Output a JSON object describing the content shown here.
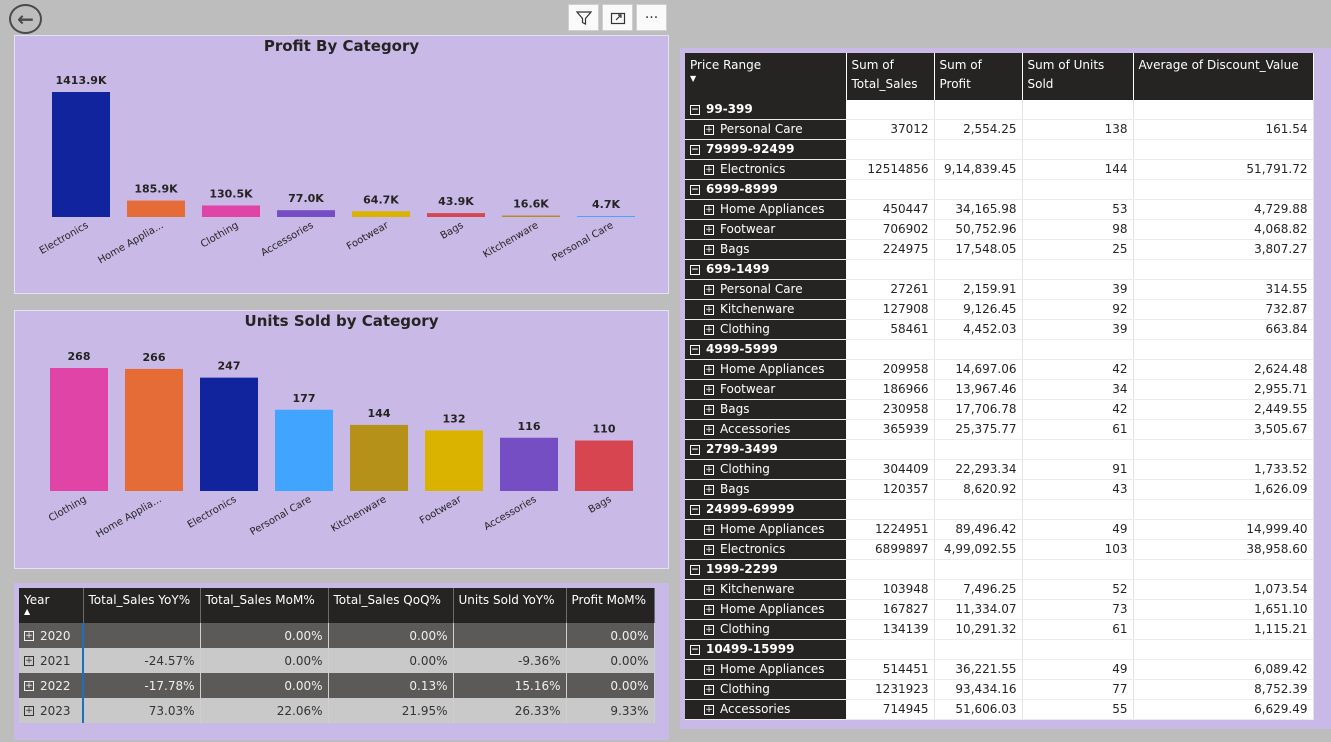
{
  "toolbar": {
    "back_icon": "back-arrow-icon",
    "filter_icon": "filter-icon",
    "focus_icon": "focus-mode-icon",
    "more_icon": "more-options-icon"
  },
  "profit_chart": {
    "chart_data": {
      "type": "bar",
      "title": "Profit By Category",
      "categories": [
        "Electronics",
        "Home Applia...",
        "Clothing",
        "Accessories",
        "Footwear",
        "Bags",
        "Kitchenware",
        "Personal Care"
      ],
      "values": [
        1413.9,
        185.9,
        130.5,
        77.0,
        64.7,
        43.9,
        16.6,
        4.7
      ],
      "labels": [
        "1413.9K",
        "185.9K",
        "130.5K",
        "77.0K",
        "64.7K",
        "43.9K",
        "16.6K",
        "4.7K"
      ],
      "colors": [
        "#12239e",
        "#e66c37",
        "#e044a7",
        "#744ec2",
        "#d9b300",
        "#d64550",
        "#b88b24",
        "#4aa3ff"
      ],
      "unit": "K"
    }
  },
  "units_chart": {
    "chart_data": {
      "type": "bar",
      "title": "Units Sold by Category",
      "categories": [
        "Clothing",
        "Home Applia...",
        "Electronics",
        "Personal Care",
        "Kitchenware",
        "Footwear",
        "Accessories",
        "Bags"
      ],
      "values": [
        268,
        266,
        247,
        177,
        144,
        132,
        116,
        110
      ],
      "colors": [
        "#e044a7",
        "#e66c37",
        "#12239e",
        "#41a4ff",
        "#b5911a",
        "#d9b300",
        "#744ec2",
        "#d64550"
      ]
    }
  },
  "matrix": {
    "headers": [
      "Price Range",
      "Sum of Total_Sales",
      "Sum of Profit",
      "Sum of Units Sold",
      "Average of Discount_Value"
    ],
    "rows": [
      {
        "type": "group",
        "label": "99-399"
      },
      {
        "type": "child",
        "label": "Personal Care",
        "values": [
          "37012",
          "2,554.25",
          "138",
          "161.54"
        ]
      },
      {
        "type": "group",
        "label": "79999-92499"
      },
      {
        "type": "child",
        "label": "Electronics",
        "values": [
          "12514856",
          "9,14,839.45",
          "144",
          "51,791.72"
        ]
      },
      {
        "type": "group",
        "label": "6999-8999"
      },
      {
        "type": "child",
        "label": "Home Appliances",
        "values": [
          "450447",
          "34,165.98",
          "53",
          "4,729.88"
        ]
      },
      {
        "type": "child",
        "label": "Footwear",
        "values": [
          "706902",
          "50,752.96",
          "98",
          "4,068.82"
        ]
      },
      {
        "type": "child",
        "label": "Bags",
        "values": [
          "224975",
          "17,548.05",
          "25",
          "3,807.27"
        ]
      },
      {
        "type": "group",
        "label": "699-1499"
      },
      {
        "type": "child",
        "label": "Personal Care",
        "values": [
          "27261",
          "2,159.91",
          "39",
          "314.55"
        ]
      },
      {
        "type": "child",
        "label": "Kitchenware",
        "values": [
          "127908",
          "9,126.45",
          "92",
          "732.87"
        ]
      },
      {
        "type": "child",
        "label": "Clothing",
        "values": [
          "58461",
          "4,452.03",
          "39",
          "663.84"
        ]
      },
      {
        "type": "group",
        "label": "4999-5999"
      },
      {
        "type": "child",
        "label": "Home Appliances",
        "values": [
          "209958",
          "14,697.06",
          "42",
          "2,624.48"
        ]
      },
      {
        "type": "child",
        "label": "Footwear",
        "values": [
          "186966",
          "13,967.46",
          "34",
          "2,955.71"
        ]
      },
      {
        "type": "child",
        "label": "Bags",
        "values": [
          "230958",
          "17,706.78",
          "42",
          "2,449.55"
        ]
      },
      {
        "type": "child",
        "label": "Accessories",
        "values": [
          "365939",
          "25,375.77",
          "61",
          "3,505.67"
        ]
      },
      {
        "type": "group",
        "label": "2799-3499"
      },
      {
        "type": "child",
        "label": "Clothing",
        "values": [
          "304409",
          "22,293.34",
          "91",
          "1,733.52"
        ]
      },
      {
        "type": "child",
        "label": "Bags",
        "values": [
          "120357",
          "8,620.92",
          "43",
          "1,626.09"
        ]
      },
      {
        "type": "group",
        "label": "24999-69999"
      },
      {
        "type": "child",
        "label": "Home Appliances",
        "values": [
          "1224951",
          "89,496.42",
          "49",
          "14,999.40"
        ]
      },
      {
        "type": "child",
        "label": "Electronics",
        "values": [
          "6899897",
          "4,99,092.55",
          "103",
          "38,958.60"
        ]
      },
      {
        "type": "group",
        "label": "1999-2299"
      },
      {
        "type": "child",
        "label": "Kitchenware",
        "values": [
          "103948",
          "7,496.25",
          "52",
          "1,073.54"
        ]
      },
      {
        "type": "child",
        "label": "Home Appliances",
        "values": [
          "167827",
          "11,334.07",
          "73",
          "1,651.10"
        ]
      },
      {
        "type": "child",
        "label": "Clothing",
        "values": [
          "134139",
          "10,291.32",
          "61",
          "1,115.21"
        ]
      },
      {
        "type": "group",
        "label": "10499-15999"
      },
      {
        "type": "child",
        "label": "Home Appliances",
        "values": [
          "514451",
          "36,221.55",
          "49",
          "6,089.42"
        ]
      },
      {
        "type": "child",
        "label": "Clothing",
        "values": [
          "1231923",
          "93,434.16",
          "77",
          "8,752.39"
        ]
      },
      {
        "type": "child",
        "label": "Accessories",
        "values": [
          "714945",
          "51,606.03",
          "55",
          "6,629.49"
        ]
      }
    ]
  },
  "yoy": {
    "headers": [
      "Year",
      "Total_Sales YoY%",
      "Total_Sales MoM%",
      "Total_Sales QoQ%",
      "Units Sold YoY%",
      "Profit MoM%"
    ],
    "rows": [
      [
        "2020",
        "",
        "0.00%",
        "0.00%",
        "",
        "0.00%"
      ],
      [
        "2021",
        "-24.57%",
        "0.00%",
        "0.00%",
        "-9.36%",
        "0.00%"
      ],
      [
        "2022",
        "-17.78%",
        "0.00%",
        "0.13%",
        "15.16%",
        "0.00%"
      ],
      [
        "2023",
        "73.03%",
        "22.06%",
        "21.95%",
        "26.33%",
        "9.33%"
      ]
    ]
  }
}
